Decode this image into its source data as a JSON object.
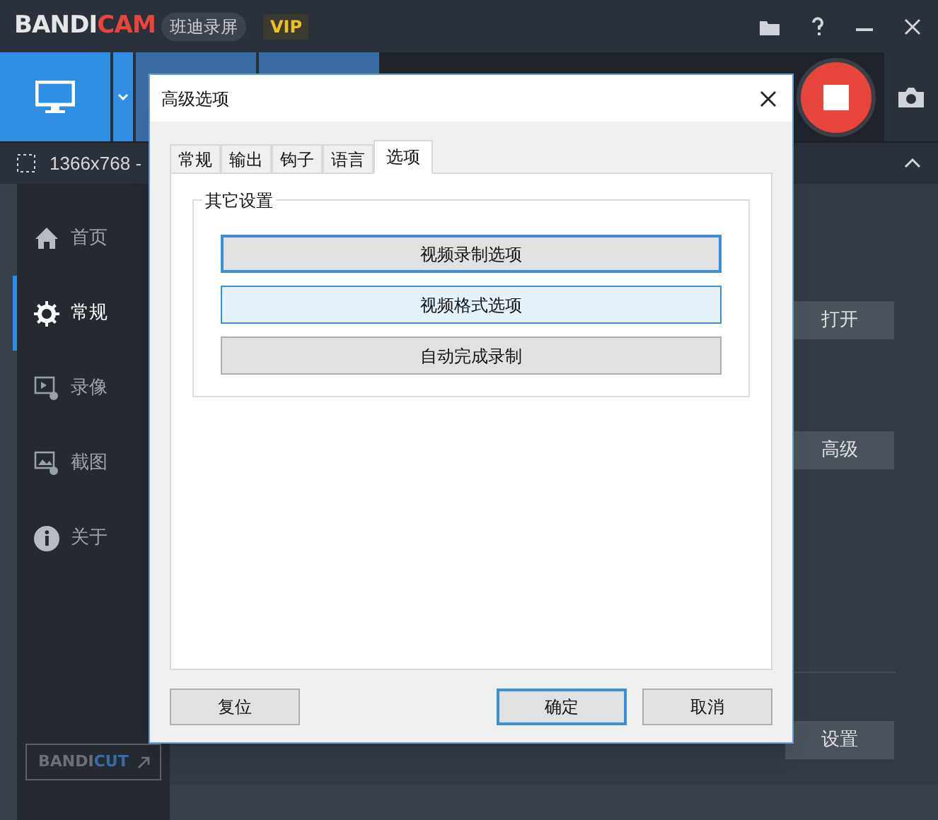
{
  "app_bar": {
    "logo_left": "BANDI",
    "logo_right": "CAM",
    "product_badge": "班迪录屏",
    "vip_badge": "VIP"
  },
  "toolbar": {
    "recording": true
  },
  "capture_bar": {
    "resolution": "1366x768 -"
  },
  "sidebar": {
    "items": [
      {
        "label": "首页",
        "kind": "home",
        "selected": false
      },
      {
        "label": "常规",
        "kind": "gear",
        "selected": true
      },
      {
        "label": "录像",
        "kind": "video",
        "selected": false
      },
      {
        "label": "截图",
        "kind": "image",
        "selected": false
      },
      {
        "label": "关于",
        "kind": "info",
        "selected": false
      }
    ],
    "promo": {
      "logo_left": "BANDI",
      "logo_right": "CUT"
    }
  },
  "main_buttons": [
    "打开",
    "高级",
    "设置"
  ],
  "dialog": {
    "title": "高级选项",
    "tabs": [
      {
        "label": "常规",
        "selected": false
      },
      {
        "label": "输出",
        "selected": false
      },
      {
        "label": "钩子",
        "selected": false
      },
      {
        "label": "语言",
        "selected": false
      },
      {
        "label": "选项",
        "selected": true
      }
    ],
    "group": {
      "title": "其它设置",
      "buttons": [
        {
          "label": "视频录制选项",
          "focused": true,
          "hovered": false
        },
        {
          "label": "视频格式选项",
          "focused": false,
          "hovered": true
        },
        {
          "label": "自动完成录制",
          "focused": false,
          "hovered": false
        }
      ]
    },
    "footer_buttons": [
      {
        "label": "复位",
        "default": false
      },
      {
        "label": "确定",
        "default": true
      },
      {
        "label": "取消",
        "default": false
      }
    ]
  }
}
